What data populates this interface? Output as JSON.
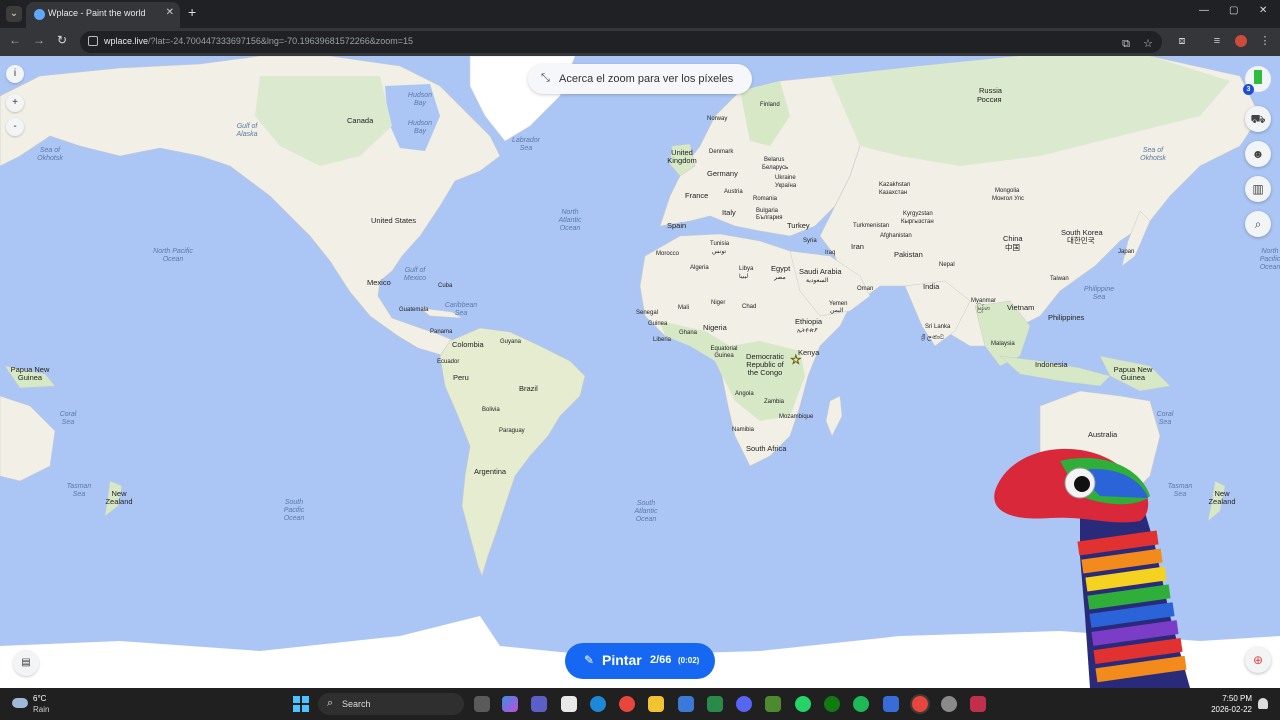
{
  "browser": {
    "tab_title": "Wplace - Paint the world",
    "url_domain": "wplace.live",
    "url_rest": "/?lat=-24.700447333697156&lng=-70.19639681572266&zoom=15",
    "window_controls": [
      "—",
      "▢",
      "✕"
    ]
  },
  "map": {
    "zoom_hint": "Acerca el zoom para ver los píxeles",
    "colors": {
      "water": "#abc6f4",
      "land": "#f1efe6",
      "green": "#d6e8c6",
      "ice": "#ffffff"
    },
    "countries": [
      "Canada",
      "United States",
      "Mexico",
      "Cuba",
      "Guatemala",
      "Panama",
      "Colombia",
      "Ecuador",
      "Guyana",
      "Peru",
      "Brazil",
      "Bolivia",
      "Paraguay",
      "Argentina",
      "Finland",
      "Norway",
      "United Kingdom",
      "Denmark",
      "Belarus",
      "Беларусь",
      "Germany",
      "Austria",
      "Ukraine",
      "Україна",
      "France",
      "Italy",
      "Romania",
      "Bulgaria",
      "България",
      "Spain",
      "Turkey",
      "Syria",
      "Tunisia",
      "تونس",
      "Morocco",
      "Algeria",
      "Libya",
      "ليبيا",
      "Egypt",
      "مصر",
      "Saudi Arabia",
      "السعودية",
      "Iraq",
      "Iran",
      "Oman",
      "Yemen",
      "اليمن",
      "Mali",
      "Niger",
      "Chad",
      "Senegal",
      "Guinea",
      "Nigeria",
      "Liberia",
      "Ghana",
      "Ethiopia",
      "ኢትዮጵያ",
      "Equatorial Guinea",
      "Kenya",
      "Democratic Republic of the Congo",
      "Angola",
      "Zambia",
      "Mozambique",
      "Namibia",
      "South Africa",
      "Russia",
      "Россия",
      "Kazakhstan",
      "Казахстан",
      "Mongolia",
      "Монгол Улс",
      "Turkmenistan",
      "Kyrgyzstan",
      "Кыргызстан",
      "Afghanistan",
      "Pakistan",
      "Nepal",
      "India",
      "China",
      "中国",
      "South Korea",
      "대한민국",
      "Japan",
      "Taiwan",
      "Myanmar",
      "မြန်မာ",
      "Vietnam",
      "Philippines",
      "Sri Lanka",
      "ශ්‍රී ලංකාව",
      "Malaysia",
      "Indonesia",
      "Papua New Guinea",
      "Australia",
      "New Zealand"
    ],
    "oceans": [
      "Hudson Bay",
      "Gulf of Alaska",
      "Labrador Sea",
      "Sea of Okhotsk",
      "North Atlantic Ocean",
      "North Pacific Ocean",
      "Gulf of Mexico",
      "Caribbean Sea",
      "South Atlantic Ocean",
      "South Pacific Ocean",
      "Coral Sea",
      "Tasman Sea",
      "Philippine Sea"
    ]
  },
  "controls": {
    "info": "i",
    "zoom_in": "+",
    "zoom_out": "-",
    "notification_count": "3"
  },
  "paint_button": {
    "label": "Pintar",
    "count": "2/66",
    "timer": "(0:02)"
  },
  "taskbar": {
    "weather_temp": "6°C",
    "weather_desc": "Rain",
    "search_label": "Search",
    "time": "7:50 PM",
    "date": "2026-02-22"
  }
}
